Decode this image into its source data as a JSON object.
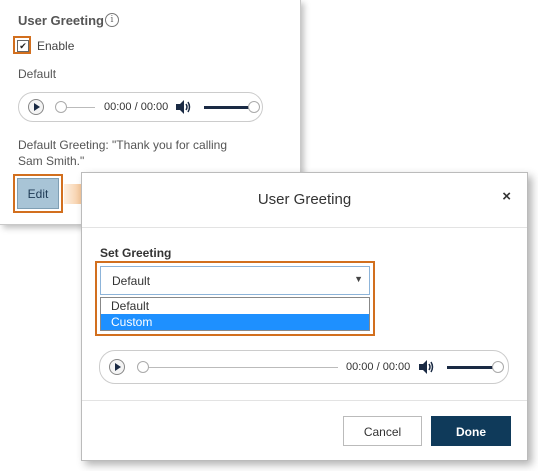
{
  "back_panel": {
    "title": "User Greeting",
    "info_symbol": "i",
    "enable_label": "Enable",
    "enabled": true,
    "greeting_mode": "Default",
    "player": {
      "time": "00:00 / 00:00",
      "progress": 0,
      "volume": 1.0
    },
    "greeting_text": "Default Greeting: \"Thank you for calling Sam Smith.\"",
    "edit_label": "Edit"
  },
  "modal": {
    "title": "User Greeting",
    "close_symbol": "×",
    "set_greeting_label": "Set Greeting",
    "select": {
      "value": "Default",
      "options": [
        "Default",
        "Custom"
      ],
      "highlighted": "Custom"
    },
    "player": {
      "time": "00:00 / 00:00",
      "progress": 0,
      "volume": 1.0
    },
    "cancel_label": "Cancel",
    "done_label": "Done"
  },
  "colors": {
    "highlight_orange": "#d26f1e",
    "done_button": "#0f3a5a",
    "edit_button": "#a8c4d6",
    "option_selected": "#1e90ff"
  },
  "icons": {
    "info": "info-icon",
    "checkbox": "checkbox-checked-icon",
    "play": "play-icon",
    "volume": "volume-icon",
    "arrow": "arrow-right-icon",
    "close": "close-icon",
    "caret": "caret-down-icon"
  }
}
